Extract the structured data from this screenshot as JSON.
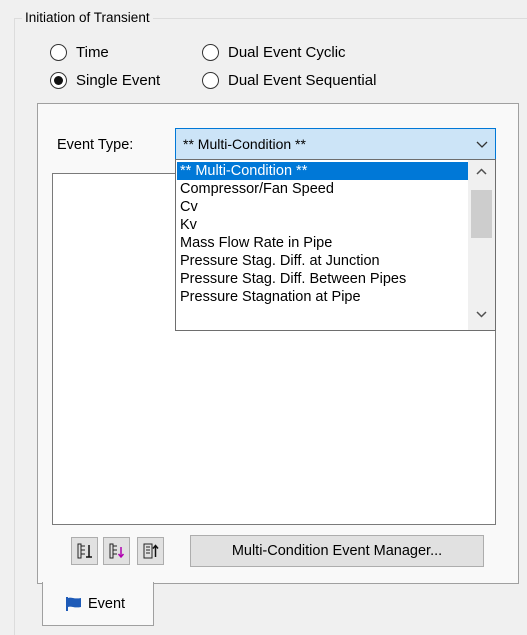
{
  "initiation": {
    "group_title": "Initiation of Transient",
    "options": [
      {
        "label": "Time",
        "selected": false
      },
      {
        "label": "Dual Event Cyclic",
        "selected": false
      },
      {
        "label": "Single Event",
        "selected": true
      },
      {
        "label": "Dual Event Sequential",
        "selected": false
      }
    ]
  },
  "event_type": {
    "label": "Event Type:",
    "selected": "** Multi-Condition **",
    "options": [
      "** Multi-Condition **",
      "Compressor/Fan Speed",
      "Cv",
      "Kv",
      "Mass Flow Rate in Pipe",
      "Pressure Stag. Diff. at Junction",
      "Pressure Stag. Diff. Between Pipes",
      "Pressure Stagnation at Pipe"
    ]
  },
  "toolbar": {
    "manager_button": "Multi-Condition Event Manager..."
  },
  "tab": {
    "label": "Event"
  },
  "colors": {
    "selection": "#0078d7",
    "combo_bg": "#cce4f7",
    "flag_blue": "#1e5bb8"
  },
  "icons": {
    "flag": "flag-icon",
    "add_item": "add-item-icon",
    "insert_item": "insert-item-icon",
    "move_up": "move-up-icon",
    "dropdown": "chevron-down-icon"
  }
}
